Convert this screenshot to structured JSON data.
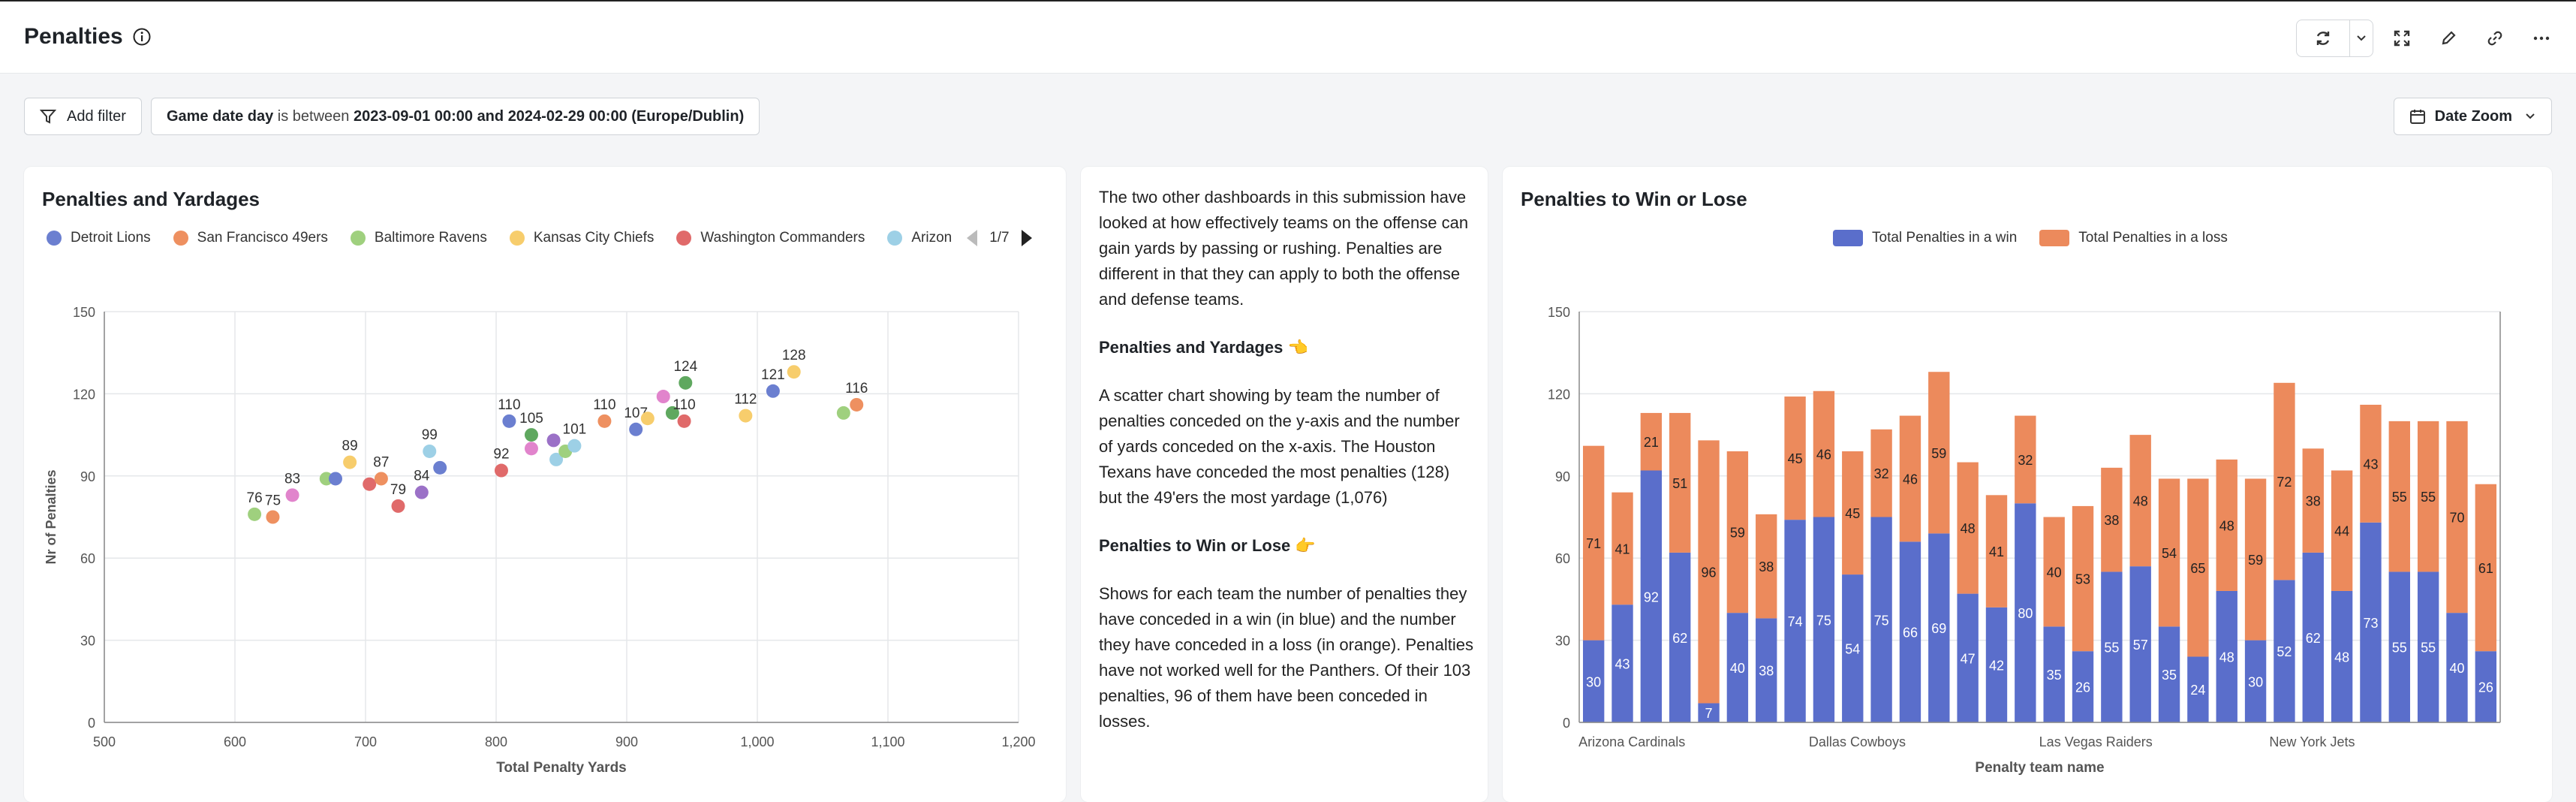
{
  "header": {
    "title": "Penalties"
  },
  "filters": {
    "add_filter": "Add filter",
    "date_filter": {
      "field": "Game date day",
      "operator": "is between",
      "start": "2023-09-01 00:00",
      "conjunction": "and",
      "end": "2024-02-29 00:00 (Europe/Dublin)"
    },
    "date_zoom": "Date Zoom"
  },
  "scatter_card": {
    "title": "Penalties and Yardages",
    "legend": [
      {
        "name": "Detroit Lions",
        "color": "#6b7fd0"
      },
      {
        "name": "San Francisco 49ers",
        "color": "#ee9060"
      },
      {
        "name": "Baltimore Ravens",
        "color": "#9fd07e"
      },
      {
        "name": "Kansas City Chiefs",
        "color": "#f7cd6c"
      },
      {
        "name": "Washington Commanders",
        "color": "#e06a6a"
      },
      {
        "name": "Arizon",
        "color": "#9dd0e6"
      }
    ],
    "pager": "1/7"
  },
  "text_card": {
    "intro": "The two other dashboards in this submission have looked at how effectively teams on the offense can gain yards by passing or rushing. Penalties are different in that they can apply to both the offense and defense teams.",
    "h1": "Penalties and Yardages 👈",
    "p1": "A scatter chart showing by team the number of penalties conceded on the y-axis and the number of yards conceded on the x-axis. The Houston Texans have conceded the most penalties (128) but the 49'ers the most yardage (1,076)",
    "h2": "Penalties to Win or Lose 👉",
    "p2": "Shows for each team the number of penalties they have conceded in a win (in blue) and the number they have conceded in a loss (in orange). Penalties have not worked well for the Panthers. Of their 103 penalties, 96 of them have been conceded in losses."
  },
  "bar_card": {
    "title": "Penalties to Win or Lose"
  },
  "chart_data": [
    {
      "type": "scatter",
      "title": "Penalties and Yardages",
      "xlabel": "Total Penalty Yards",
      "ylabel": "Nr of Penalties",
      "xlim": [
        500,
        1200
      ],
      "ylim": [
        0,
        150
      ],
      "xticks": [
        "500",
        "600",
        "700",
        "800",
        "900",
        "1,000",
        "1,100",
        "1,200"
      ],
      "yticks": [
        "0",
        "30",
        "60",
        "90",
        "120",
        "150"
      ],
      "grid": true,
      "legend_position": "top-left",
      "points": [
        {
          "x": 615,
          "y": 76,
          "color": "#9fd07e",
          "label": "76"
        },
        {
          "x": 629,
          "y": 75,
          "color": "#ee9060",
          "label": "75"
        },
        {
          "x": 644,
          "y": 83,
          "color": "#e184cc",
          "label": "83"
        },
        {
          "x": 670,
          "y": 89,
          "color": "#9fd07e",
          "label": ""
        },
        {
          "x": 677,
          "y": 89,
          "color": "#6b7fd0",
          "label": ""
        },
        {
          "x": 688,
          "y": 95,
          "color": "#f7cd6c",
          "label": "89"
        },
        {
          "x": 703,
          "y": 87,
          "color": "#e06a6a",
          "label": ""
        },
        {
          "x": 712,
          "y": 89,
          "color": "#ee9060",
          "label": "87"
        },
        {
          "x": 725,
          "y": 79,
          "color": "#e06a6a",
          "label": "79"
        },
        {
          "x": 743,
          "y": 84,
          "color": "#9b71c7",
          "label": "84"
        },
        {
          "x": 749,
          "y": 99,
          "color": "#9dd0e6",
          "label": "99"
        },
        {
          "x": 757,
          "y": 93,
          "color": "#6b7fd0",
          "label": ""
        },
        {
          "x": 804,
          "y": 92,
          "color": "#e06a6a",
          "label": "92"
        },
        {
          "x": 810,
          "y": 110,
          "color": "#6b7fd0",
          "label": "110"
        },
        {
          "x": 827,
          "y": 100,
          "color": "#e184cc",
          "label": ""
        },
        {
          "x": 827,
          "y": 105,
          "color": "#5fa85f",
          "label": "105"
        },
        {
          "x": 844,
          "y": 103,
          "color": "#9b71c7",
          "label": ""
        },
        {
          "x": 846,
          "y": 96,
          "color": "#9dd0e6",
          "label": ""
        },
        {
          "x": 853,
          "y": 99,
          "color": "#9fd07e",
          "label": ""
        },
        {
          "x": 860,
          "y": 101,
          "color": "#9dd0e6",
          "label": "101"
        },
        {
          "x": 883,
          "y": 110,
          "color": "#ee9060",
          "label": "110"
        },
        {
          "x": 907,
          "y": 107,
          "color": "#6b7fd0",
          "label": "107"
        },
        {
          "x": 916,
          "y": 111,
          "color": "#f7cd6c",
          "label": ""
        },
        {
          "x": 928,
          "y": 119,
          "color": "#e184cc",
          "label": ""
        },
        {
          "x": 935,
          "y": 113,
          "color": "#5fa85f",
          "label": ""
        },
        {
          "x": 944,
          "y": 110,
          "color": "#e06a6a",
          "label": "110"
        },
        {
          "x": 945,
          "y": 124,
          "color": "#5fa85f",
          "label": "124"
        },
        {
          "x": 991,
          "y": 112,
          "color": "#f7cd6c",
          "label": "112"
        },
        {
          "x": 1012,
          "y": 121,
          "color": "#6b7fd0",
          "label": "121"
        },
        {
          "x": 1028,
          "y": 128,
          "color": "#f7cd6c",
          "label": "128"
        },
        {
          "x": 1066,
          "y": 113,
          "color": "#9fd07e",
          "label": ""
        },
        {
          "x": 1076,
          "y": 116,
          "color": "#ee9060",
          "label": "116"
        }
      ]
    },
    {
      "type": "bar",
      "stacked": true,
      "title": "Penalties to Win or Lose",
      "xlabel": "Penalty team name",
      "ylabel": "",
      "ylim": [
        0,
        150
      ],
      "yticks": [
        "0",
        "30",
        "60",
        "90",
        "120",
        "150"
      ],
      "grid": true,
      "legend_position": "top",
      "x_tick_labels": [
        {
          "index": 0,
          "label": "Arizona Cardinals"
        },
        {
          "index": 8,
          "label": "Dallas Cowboys"
        },
        {
          "index": 16,
          "label": "Las Vegas Raiders"
        },
        {
          "index": 24,
          "label": "New York Jets"
        }
      ],
      "series": [
        {
          "name": "Total Penalties in a win",
          "color": "#5a6ecb",
          "values": [
            30,
            43,
            92,
            62,
            7,
            40,
            38,
            74,
            75,
            54,
            75,
            66,
            69,
            47,
            42,
            80,
            35,
            26,
            55,
            57,
            35,
            24,
            48,
            30,
            52,
            62,
            48,
            73,
            55,
            55,
            40,
            26
          ]
        },
        {
          "name": "Total Penalties in a loss",
          "color": "#ec8a5c",
          "values": [
            71,
            41,
            21,
            51,
            96,
            59,
            38,
            45,
            46,
            45,
            32,
            46,
            59,
            48,
            41,
            32,
            40,
            53,
            38,
            48,
            54,
            65,
            48,
            59,
            72,
            38,
            44,
            43,
            55,
            55,
            70,
            61
          ]
        }
      ]
    }
  ]
}
